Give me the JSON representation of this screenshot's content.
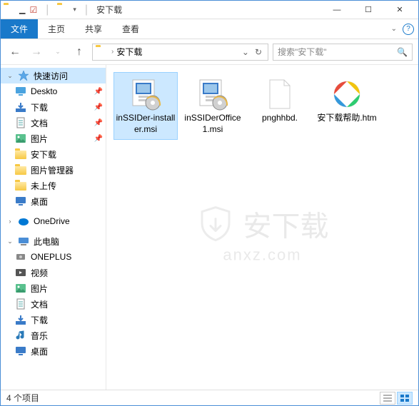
{
  "window": {
    "title": "安下载",
    "qat_dropdown": "▾"
  },
  "ribbon": {
    "tabs": [
      "文件",
      "主页",
      "共享",
      "查看"
    ],
    "active_index": 0
  },
  "nav": {
    "breadcrumb_root_glyph": "",
    "breadcrumb": [
      "安下载"
    ],
    "search_placeholder": "搜索\"安下载\"",
    "refresh_glyph": "↻"
  },
  "sidebar": {
    "groups": [
      {
        "label": "快速访问",
        "icon": "star",
        "expanded": true,
        "selected": true,
        "items": [
          {
            "label": "Deskto",
            "icon": "desktop",
            "pinned": true
          },
          {
            "label": "下载",
            "icon": "download",
            "pinned": true
          },
          {
            "label": "文档",
            "icon": "doc",
            "pinned": true
          },
          {
            "label": "图片",
            "icon": "pictures",
            "pinned": true
          },
          {
            "label": "安下载",
            "icon": "folder",
            "pinned": false
          },
          {
            "label": "图片管理器",
            "icon": "folder",
            "pinned": false
          },
          {
            "label": "未上传",
            "icon": "folder",
            "pinned": false
          },
          {
            "label": "桌面",
            "icon": "desktop2",
            "pinned": false
          }
        ]
      },
      {
        "label": "OneDrive",
        "icon": "onedrive",
        "expanded": false,
        "items": []
      },
      {
        "label": "此电脑",
        "icon": "pc",
        "expanded": true,
        "items": [
          {
            "label": "ONEPLUS",
            "icon": "device"
          },
          {
            "label": "视频",
            "icon": "video"
          },
          {
            "label": "图片",
            "icon": "pictures"
          },
          {
            "label": "文档",
            "icon": "doc"
          },
          {
            "label": "下载",
            "icon": "download"
          },
          {
            "label": "音乐",
            "icon": "music"
          },
          {
            "label": "桌面",
            "icon": "desktop2"
          }
        ]
      }
    ]
  },
  "files": [
    {
      "name": "inSSIDer-installer.msi",
      "type": "msi",
      "selected": true
    },
    {
      "name": "inSSIDerOffice1.msi",
      "type": "msi",
      "selected": false
    },
    {
      "name": "pnghhbd.",
      "type": "blank",
      "selected": false
    },
    {
      "name": "安下载帮助.htm",
      "type": "htm",
      "selected": false
    }
  ],
  "watermark": {
    "text": "安下载",
    "sub": "anxz.com"
  },
  "status": {
    "text": "4 个项目"
  }
}
